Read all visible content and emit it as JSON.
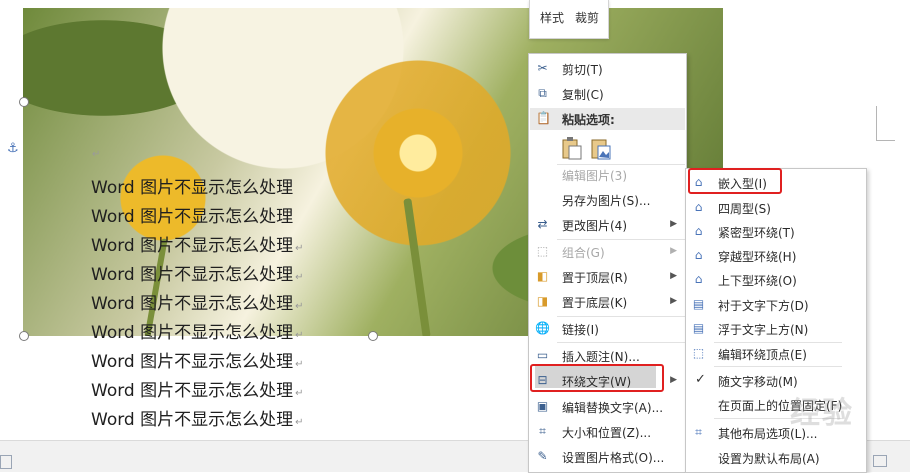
{
  "mini_toolbar": {
    "style_label": "样式",
    "crop_label": "裁剪"
  },
  "document": {
    "lines": [
      "Word 图片不显示怎么处理",
      "Word 图片不显示怎么处理",
      "Word 图片不显示怎么处理",
      "Word 图片不显示怎么处理",
      "Word 图片不显示怎么处理",
      "Word 图片不显示怎么处理",
      "Word 图片不显示怎么处理",
      "Word 图片不显示怎么处理",
      "Word 图片不显示怎么处理"
    ],
    "paragraph_mark": "↵"
  },
  "context_menu": {
    "cut": "剪切(T)",
    "copy": "复制(C)",
    "paste_options": "粘贴选项:",
    "edit_picture": "编辑图片(3)",
    "save_as_picture": "另存为图片(S)...",
    "change_picture": "更改图片(4)",
    "group": "组合(G)",
    "bring_to_front": "置于顶层(R)",
    "send_to_back": "置于底层(K)",
    "link": "链接(I)",
    "insert_caption": "插入题注(N)...",
    "wrap_text": "环绕文字(W)",
    "edit_alt_text": "编辑替换文字(A)...",
    "size_position": "大小和位置(Z)...",
    "format_picture": "设置图片格式(O)..."
  },
  "wrap_submenu": {
    "inline": "嵌入型(I)",
    "square": "四周型(S)",
    "tight": "紧密型环绕(T)",
    "through": "穿越型环绕(H)",
    "top_bottom": "上下型环绕(O)",
    "behind_text": "衬于文字下方(D)",
    "in_front": "浮于文字上方(N)",
    "edit_wrap_points": "编辑环绕顶点(E)",
    "move_with_text": "随文字移动(M)",
    "fix_position": "在页面上的位置固定(F)",
    "more_layout": "其他布局选项(L)...",
    "set_default": "设置为默认布局(A)"
  },
  "colors": {
    "highlight_border": "#e02020",
    "menu_hover": "#d5d5d5"
  },
  "watermark": "经验"
}
